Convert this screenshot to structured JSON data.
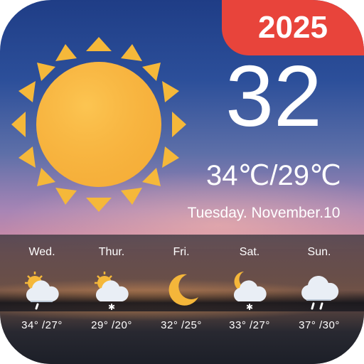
{
  "badge": {
    "year": "2025"
  },
  "current": {
    "temperature": "32",
    "range": "34℃/29℃",
    "date": "Tuesday. November.10",
    "icon": "sun-icon"
  },
  "forecast": [
    {
      "day": "Wed.",
      "temps": "34° /27°",
      "icon": "sun-cloud-rain-icon"
    },
    {
      "day": "Thur.",
      "temps": "29° /20°",
      "icon": "sun-cloud-snow-icon"
    },
    {
      "day": "Fri.",
      "temps": "32° /25°",
      "icon": "moon-icon"
    },
    {
      "day": "Sat.",
      "temps": "33° /27°",
      "icon": "moon-cloud-snow-icon"
    },
    {
      "day": "Sun.",
      "temps": "37° /30°",
      "icon": "cloud-rain-icon"
    }
  ],
  "colors": {
    "badge": "#e8443b",
    "sun": "#f5b83a",
    "moon": "#f4b63a",
    "text": "#ffffff"
  }
}
